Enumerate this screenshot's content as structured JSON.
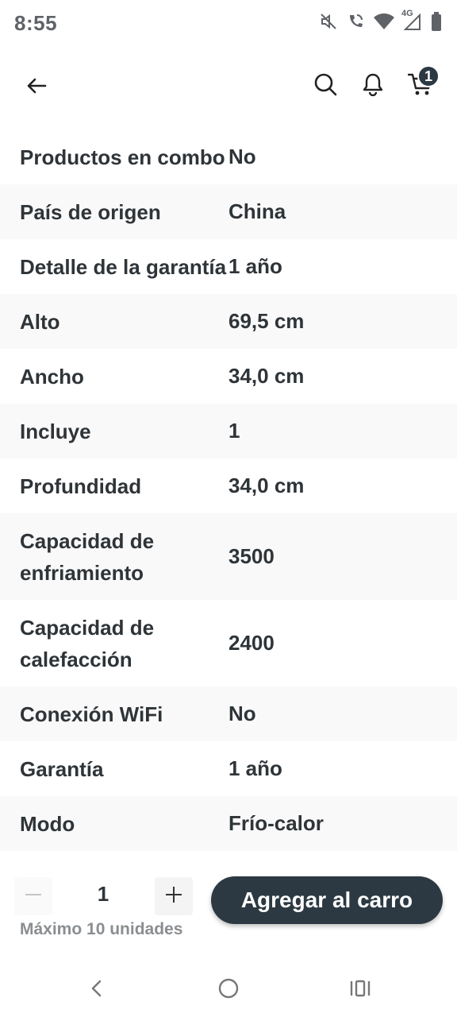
{
  "status_bar": {
    "time": "8:55",
    "network_label": "4G",
    "icons": [
      "mute-icon",
      "wifi-call-icon",
      "wifi-icon",
      "signal-icon",
      "battery-icon"
    ]
  },
  "app_bar": {
    "icons": [
      "back-arrow-icon",
      "search-icon",
      "bell-icon",
      "cart-icon"
    ],
    "cart_count": "1"
  },
  "specs": [
    {
      "label": "Productos en combo",
      "value": "No"
    },
    {
      "label": "País de origen",
      "value": "China"
    },
    {
      "label": "Detalle de la garantía",
      "value": "1 año"
    },
    {
      "label": "Alto",
      "value": "69,5 cm"
    },
    {
      "label": "Ancho",
      "value": "34,0 cm"
    },
    {
      "label": "Incluye",
      "value": "1"
    },
    {
      "label": "Profundidad",
      "value": "34,0 cm"
    },
    {
      "label": "Capacidad de enfriamiento",
      "value": "3500"
    },
    {
      "label": "Capacidad de calefacción",
      "value": "2400"
    },
    {
      "label": "Conexión WiFi",
      "value": "No"
    },
    {
      "label": "Garantía",
      "value": "1 año"
    },
    {
      "label": "Modo",
      "value": "Frío-calor"
    }
  ],
  "purchase": {
    "quantity": "1",
    "max_units": "Máximo 10 unidades",
    "add_to_cart": "Agregar al carro"
  },
  "colors": {
    "primary": "#2c3942",
    "text": "#2f3438",
    "muted": "#8a8e91",
    "row_alt": "#f9f9f9"
  },
  "nav_bar": {
    "icons": [
      "nav-back-icon",
      "nav-home-icon",
      "nav-recents-icon"
    ]
  }
}
